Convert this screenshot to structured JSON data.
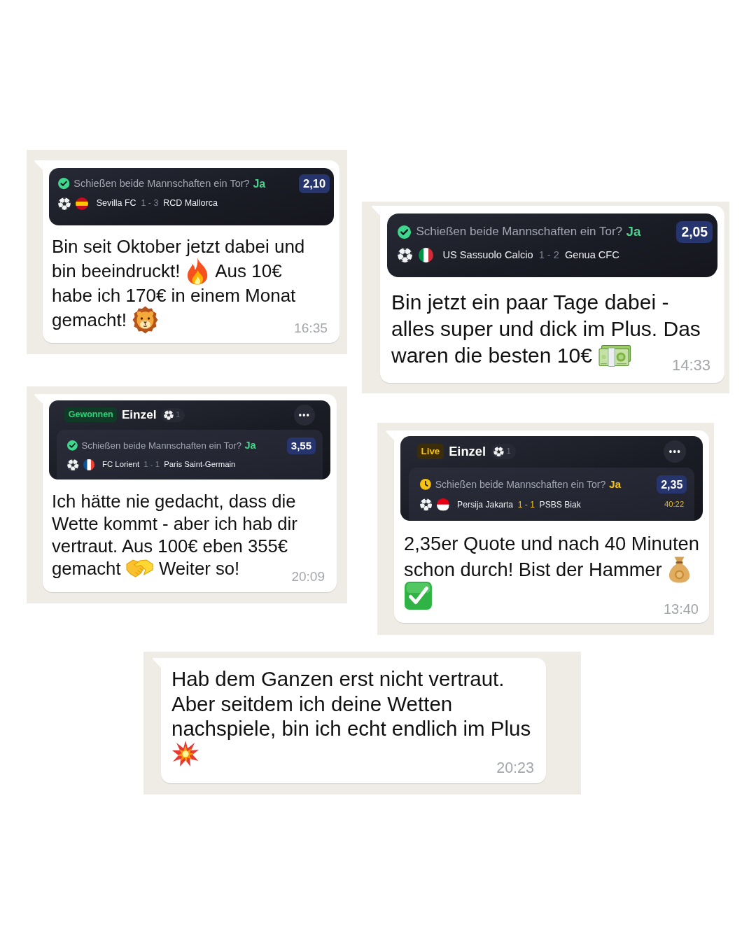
{
  "messages": [
    {
      "bet": {
        "selection": {
          "live": false,
          "question": "Schießen beide Mannschaften ein Tor?",
          "pick": "Ja",
          "odds": "2,10",
          "flag": {
            "kind": "horizontal",
            "stripes": [
              {
                "color": "#c60b1e"
              },
              {
                "color": "#ffc400"
              },
              {
                "color": "#c60b1e"
              }
            ]
          },
          "home": "Sevilla FC",
          "score": "1 - 3",
          "away": "RCD Mallorca"
        }
      },
      "lines": [
        [
          {
            "kind": "text",
            "text": "Bin seit Oktober jetzt dabei und"
          }
        ],
        [
          {
            "kind": "text",
            "text": "bin beeindruckt!"
          },
          {
            "kind": "fire"
          },
          {
            "kind": "text",
            "text": "Aus 10€"
          }
        ],
        [
          {
            "kind": "text",
            "text": "habe ich 170€ in einem Monat"
          }
        ],
        [
          {
            "kind": "text",
            "text": "gemacht!"
          },
          {
            "kind": "lion"
          }
        ]
      ],
      "time": "16:35"
    },
    {
      "bet": {
        "selection": {
          "live": false,
          "question": "Schießen beide Mannschaften ein Tor?",
          "pick": "Ja",
          "odds": "2,05",
          "flag": {
            "kind": "vertical",
            "stripes": [
              {
                "color": "#009246"
              },
              {
                "color": "#ffffff"
              },
              {
                "color": "#ce2b37"
              }
            ]
          },
          "home": "US Sassuolo Calcio",
          "score": "1 - 2",
          "away": "Genua CFC"
        }
      },
      "lines": [
        [
          {
            "kind": "text",
            "text": "Bin jetzt ein paar Tage dabei -"
          }
        ],
        [
          {
            "kind": "text",
            "text": "alles super und dick im Plus. Das"
          }
        ],
        [
          {
            "kind": "text",
            "text": "waren die besten 10€"
          },
          {
            "kind": "banknotes"
          }
        ]
      ],
      "time": "14:33"
    },
    {
      "bet": {
        "header": {
          "live": false,
          "status_label": "Gewonnen",
          "type": "Einzel",
          "count": "1"
        },
        "selection": {
          "live": false,
          "question": "Schießen beide Mannschaften ein Tor?",
          "pick": "Ja",
          "odds": "3,55",
          "flag": {
            "kind": "vertical",
            "stripes": [
              {
                "color": "#0055a4"
              },
              {
                "color": "#ffffff"
              },
              {
                "color": "#ef4135"
              }
            ]
          },
          "home": "FC Lorient",
          "score": "1 - 1",
          "away": "Paris Saint-Germain"
        }
      },
      "lines": [
        [
          {
            "kind": "text",
            "text": "Ich hätte nie gedacht, dass die"
          }
        ],
        [
          {
            "kind": "text",
            "text": "Wette kommt - aber ich hab dir"
          }
        ],
        [
          {
            "kind": "text",
            "text": "vertraut. Aus 100€ eben 355€"
          }
        ],
        [
          {
            "kind": "text",
            "text": "gemacht"
          },
          {
            "kind": "handshake"
          },
          {
            "kind": "text",
            "text": "Weiter so!"
          }
        ]
      ],
      "time": "20:09"
    },
    {
      "bet": {
        "header": {
          "live": true,
          "status_label": "Live",
          "type": "Einzel",
          "count": "1"
        },
        "selection": {
          "live": true,
          "question": "Schießen beide Mannschaften ein Tor?",
          "pick": "Ja",
          "odds": "2,35",
          "flag": {
            "kind": "horizontal",
            "stripes": [
              {
                "color": "#e70011"
              },
              {
                "color": "#ffffff"
              }
            ]
          },
          "home": "Persija Jakarta",
          "score": "1 - 1",
          "away": "PSBS Biak",
          "clock": "40:22"
        }
      },
      "lines": [
        [
          {
            "kind": "text",
            "text": "2,35er Quote und nach 40 Minuten"
          }
        ],
        [
          {
            "kind": "text",
            "text": "schon durch! Bist der Hammer"
          },
          {
            "kind": "moneybag"
          }
        ],
        [
          {
            "kind": "checkmark"
          }
        ]
      ],
      "time": "13:40"
    },
    {
      "lines": [
        [
          {
            "kind": "text",
            "text": "Hab dem Ganzen erst nicht vertraut."
          }
        ],
        [
          {
            "kind": "text",
            "text": "Aber seitdem ich deine Wetten"
          }
        ],
        [
          {
            "kind": "text",
            "text": "nachspiele, bin ich echt endlich im Plus"
          }
        ],
        [
          {
            "kind": "collision"
          }
        ]
      ],
      "time": "20:23"
    }
  ]
}
